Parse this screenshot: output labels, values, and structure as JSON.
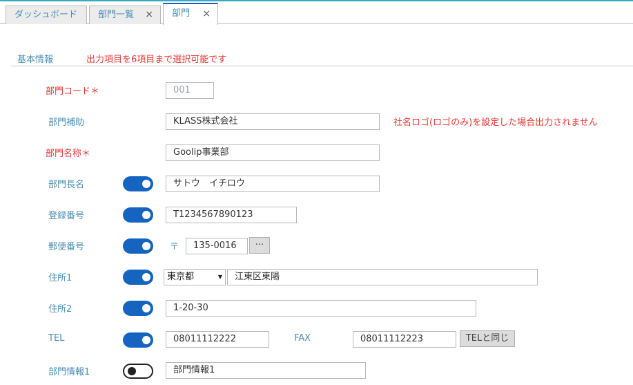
{
  "tabs": [
    {
      "label": "ダッシュボード"
    },
    {
      "label": "部門一覧",
      "close": "×"
    },
    {
      "label": "部門",
      "close": "×"
    }
  ],
  "section": {
    "title": "基本情報",
    "note": "出力項目を6項目まで選択可能です"
  },
  "fields": {
    "code": {
      "label": "部門コード＊",
      "value": "001"
    },
    "supplement": {
      "label": "部門補助",
      "value": "KLASS株式会社",
      "note": "社名ロゴ(ロゴのみ)を設定した場合出力されません"
    },
    "name": {
      "label": "部門名称＊",
      "value": "Goolip事業部"
    },
    "manager": {
      "label": "部門長名",
      "value": "サトウ　イチロウ",
      "toggle_on": true
    },
    "registration": {
      "label": "登録番号",
      "value": "T1234567890123",
      "toggle_on": true
    },
    "postal": {
      "label": "郵便番号",
      "mark": "〒",
      "value": "135-0016",
      "lookup_label": "···",
      "toggle_on": true
    },
    "address1": {
      "label": "住所1",
      "prefecture": "東京都",
      "value": "江東区東陽",
      "toggle_on": true
    },
    "address2": {
      "label": "住所2",
      "value": "1-20-30",
      "toggle_on": true
    },
    "tel": {
      "label": "TEL",
      "value": "08011112222",
      "toggle_on": true
    },
    "fax": {
      "label": "FAX",
      "value": "08011112223",
      "same_button": "TELと同じ"
    },
    "info1": {
      "label": "部門情報1",
      "value": "部門情報1",
      "toggle_on": false
    }
  }
}
